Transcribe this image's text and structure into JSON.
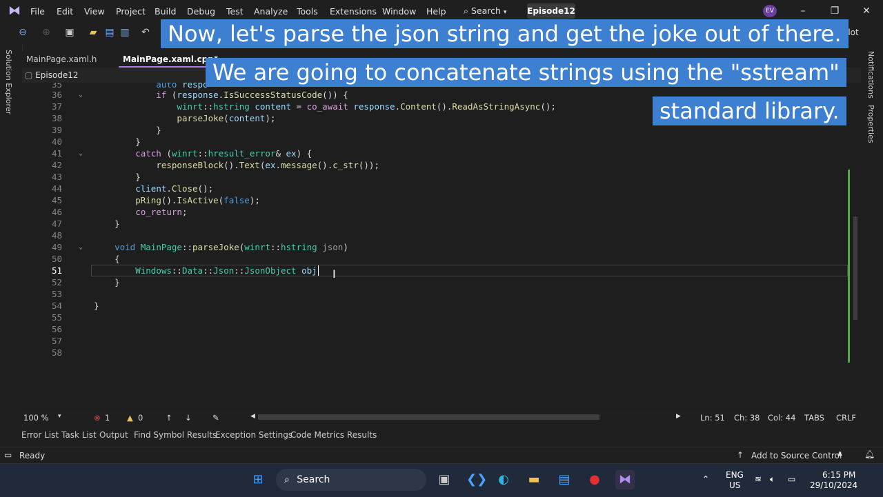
{
  "menu": {
    "items": [
      "File",
      "Edit",
      "View",
      "Project",
      "Build",
      "Debug",
      "Test",
      "Analyze",
      "Tools",
      "Extensions",
      "Window",
      "Help"
    ],
    "search_label": "Search",
    "solution": "Episode12",
    "avatar_initials": "EV",
    "copilot_partial": "ilot"
  },
  "tabs": [
    {
      "label": "MainPage.xaml.h"
    },
    {
      "label": "MainPage.xaml.cpp*"
    }
  ],
  "nav": {
    "project": "Episode12"
  },
  "sidebars": {
    "left": "Solution Explorer",
    "right_top": "Notifications",
    "right_bottom": "Properties"
  },
  "captions": [
    "Now, let's parse the json string and get the joke out of there.",
    "We are going to concatenate strings using the \"sstream\"",
    "standard library."
  ],
  "editor": {
    "current_line": 51,
    "lines": [
      {
        "n": "35",
        "t": "            auto respo"
      },
      {
        "n": "36",
        "t": "            if (response.IsSuccessStatusCode()) {"
      },
      {
        "n": "37",
        "t": "                winrt::hstring content = co_await response.Content().ReadAsStringAsync();"
      },
      {
        "n": "38",
        "t": "                parseJoke(content);"
      },
      {
        "n": "39",
        "t": "            }"
      },
      {
        "n": "40",
        "t": "        }"
      },
      {
        "n": "41",
        "t": "        catch (winrt::hresult_error& ex) {"
      },
      {
        "n": "42",
        "t": "            responseBlock().Text(ex.message().c_str());"
      },
      {
        "n": "43",
        "t": "        }"
      },
      {
        "n": "44",
        "t": "        client.Close();"
      },
      {
        "n": "45",
        "t": "        pRing().IsActive(false);"
      },
      {
        "n": "46",
        "t": "        co_return;"
      },
      {
        "n": "47",
        "t": "    }"
      },
      {
        "n": "48",
        "t": ""
      },
      {
        "n": "49",
        "t": "    void MainPage::parseJoke(winrt::hstring json)"
      },
      {
        "n": "50",
        "t": "    {"
      },
      {
        "n": "51",
        "t": "        Windows::Data::Json::JsonObject obj"
      },
      {
        "n": "52",
        "t": "    }"
      },
      {
        "n": "53",
        "t": ""
      },
      {
        "n": "54",
        "t": "}"
      },
      {
        "n": "55",
        "t": ""
      },
      {
        "n": "56",
        "t": ""
      },
      {
        "n": "57",
        "t": ""
      },
      {
        "n": "58",
        "t": ""
      }
    ]
  },
  "editor_status": {
    "zoom": "100 %",
    "errors": "1",
    "warnings": "0",
    "ln": "Ln: 51",
    "ch": "Ch: 38",
    "col": "Col: 44",
    "tabs": "TABS",
    "eol": "CRLF"
  },
  "tool_tabs": [
    "Error List",
    "Task List",
    "Output",
    "Find Symbol Results",
    "Exception Settings",
    "Code Metrics Results"
  ],
  "status": {
    "left": "Ready",
    "right": "Add to Source Control"
  },
  "taskbar": {
    "search": "Search",
    "lang_1": "ENG",
    "lang_2": "US",
    "time": "6:15 PM",
    "date": "29/10/2024"
  },
  "colors": {
    "caption_bg": "#3d7fd1",
    "accent": "#a47fe0",
    "change_bar": "#57a64a"
  }
}
